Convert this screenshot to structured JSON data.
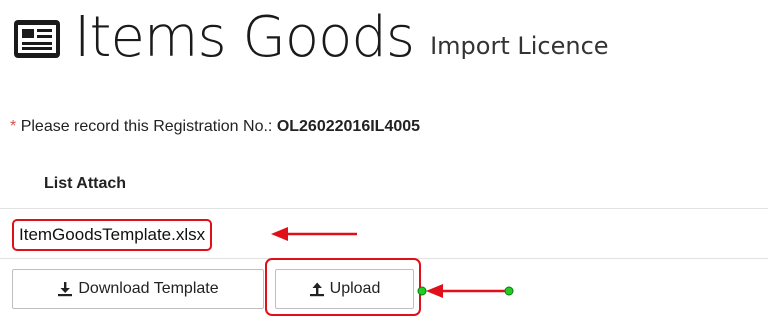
{
  "header": {
    "title_icon": "list-card-icon",
    "title": "Items Goods",
    "subtitle": "Import Licence"
  },
  "note": {
    "asterisk": "*",
    "text": "Please record this Registration No.:",
    "registration_no": "OL26022016IL4005"
  },
  "attachments": {
    "label": "List Attach",
    "file_name": "ItemGoodsTemplate.xlsx"
  },
  "actions": {
    "download": {
      "icon": "download-icon",
      "label": "Download Template"
    },
    "upload": {
      "icon": "upload-icon",
      "label": "Upload"
    }
  },
  "colors": {
    "highlight": "#e0101a",
    "endpoint": "#22cc22",
    "asterisk": "#d9534f"
  }
}
